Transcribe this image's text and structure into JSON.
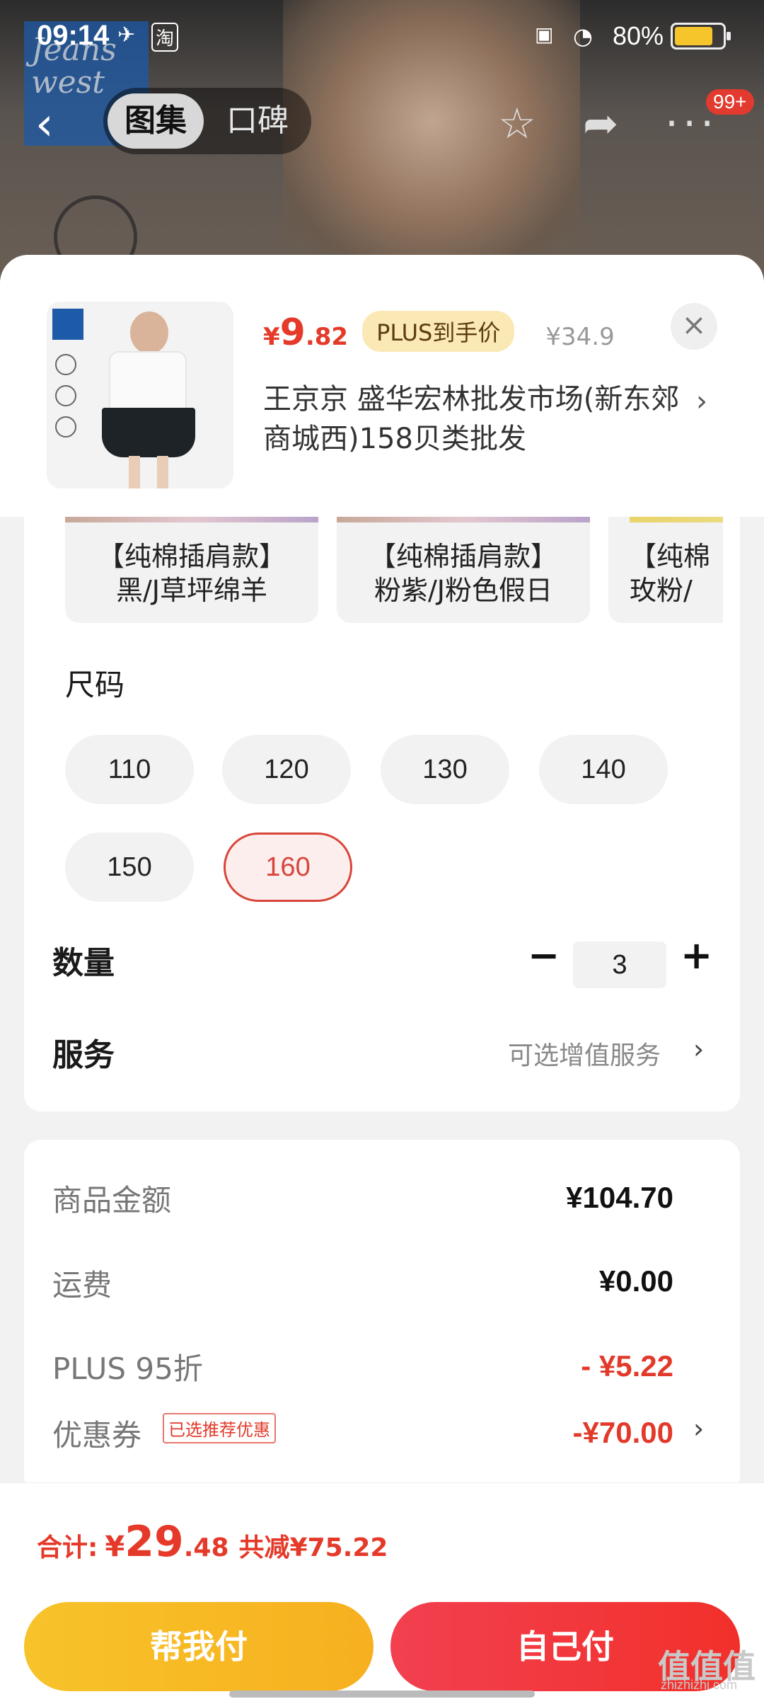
{
  "status": {
    "time": "09:14",
    "battery_pct": "80%",
    "battery_level": 0.8,
    "icons": [
      "bird-notification-icon",
      "taobao-notification-icon",
      "sim-icon",
      "wifi-icon"
    ]
  },
  "background": {
    "brand_logo_text": "Jeans west 真维斯",
    "tabs": [
      "图集",
      "口碑"
    ],
    "active_tab": "图集",
    "badge": "99+"
  },
  "product": {
    "price_currency": "¥",
    "price_int": "9",
    "price_dec": ".82",
    "plus_tag": "PLUS到手价",
    "orig_price": "¥34.9",
    "close": "×",
    "seller": "王京京  盛华宏林批发市场(新东郊商城西)158贝类批发",
    "chevron": "›"
  },
  "variants": [
    {
      "line1": "【纯棉插肩款】",
      "line2": "黑/J草坪绵羊"
    },
    {
      "line1": "【纯棉插肩款】",
      "line2": "粉紫/J粉色假日"
    },
    {
      "line1": "【纯棉",
      "line2": "玫粉/"
    }
  ],
  "size": {
    "label": "尺码",
    "options": [
      "110",
      "120",
      "130",
      "140",
      "150",
      "160"
    ],
    "selected": "160"
  },
  "quantity": {
    "label": "数量",
    "minus": "−",
    "value": "3",
    "plus": "+"
  },
  "service": {
    "label": "服务",
    "value": "可选增值服务",
    "chevron": "›"
  },
  "fees": {
    "goods_label": "商品金额",
    "goods_value": "¥104.70",
    "shipping_label": "运费",
    "shipping_value": "¥0.00",
    "plus_label": "PLUS 95折",
    "plus_value": "- ¥5.22",
    "coupon_label": "优惠券",
    "coupon_tag": "已选推荐优惠",
    "coupon_value": "-¥70.00",
    "coupon_chevron": "›"
  },
  "footer": {
    "total_label": "合计:",
    "total_currency": "¥",
    "total_int": "29",
    "total_dec": ".48",
    "total_saving": "共减¥75.22",
    "help_pay": "帮我付",
    "self_pay": "自己付"
  },
  "watermark": {
    "main": "值值值",
    "sub": "zhizhizhi.com"
  },
  "colors": {
    "accent_red": "#e53a2a",
    "help_btn": "#f7c32a",
    "self_btn": "#f2302a",
    "plus_tag_bg": "#fbe9b5"
  }
}
